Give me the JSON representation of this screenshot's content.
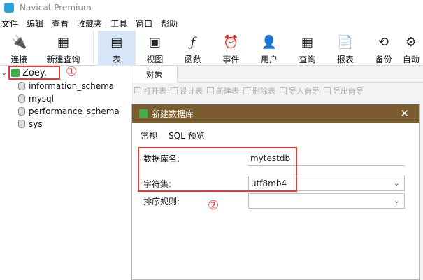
{
  "window": {
    "title": "Navicat Premium"
  },
  "menu": [
    "文件",
    "编辑",
    "查看",
    "收藏夹",
    "工具",
    "窗口",
    "帮助"
  ],
  "toolbar": [
    {
      "label": "连接",
      "icon": "plug-icon"
    },
    {
      "label": "新建查询",
      "icon": "new-query-icon"
    },
    {
      "label": "表",
      "icon": "table-icon"
    },
    {
      "label": "视图",
      "icon": "view-icon"
    },
    {
      "label": "函数",
      "icon": "function-icon"
    },
    {
      "label": "事件",
      "icon": "clock-icon"
    },
    {
      "label": "用户",
      "icon": "user-icon"
    },
    {
      "label": "查询",
      "icon": "query-icon"
    },
    {
      "label": "报表",
      "icon": "report-icon"
    },
    {
      "label": "备份",
      "icon": "backup-icon"
    },
    {
      "label": "自动",
      "icon": "automation-icon"
    }
  ],
  "sidebar": {
    "connection": "Zoey.",
    "annotation1": "①",
    "databases": [
      "information_schema",
      "mysql",
      "performance_schema",
      "sys"
    ]
  },
  "main": {
    "tab": "对象",
    "object_toolbar": [
      "打开表",
      "设计表",
      "新建表",
      "删除表",
      "导入向导",
      "导出向导"
    ]
  },
  "dialog": {
    "title": "新建数据库",
    "tabs": [
      "常规",
      "SQL 预览"
    ],
    "fields": {
      "db_name_label": "数据库名:",
      "db_name_value": "mytestdb",
      "charset_label": "字符集:",
      "charset_value": "utf8mb4",
      "collation_label": "排序规则:",
      "collation_value": ""
    },
    "annotation2": "②"
  },
  "colors": {
    "annotation_red": "#e53b3b",
    "dialog_title_bg": "#7a5c2e"
  }
}
